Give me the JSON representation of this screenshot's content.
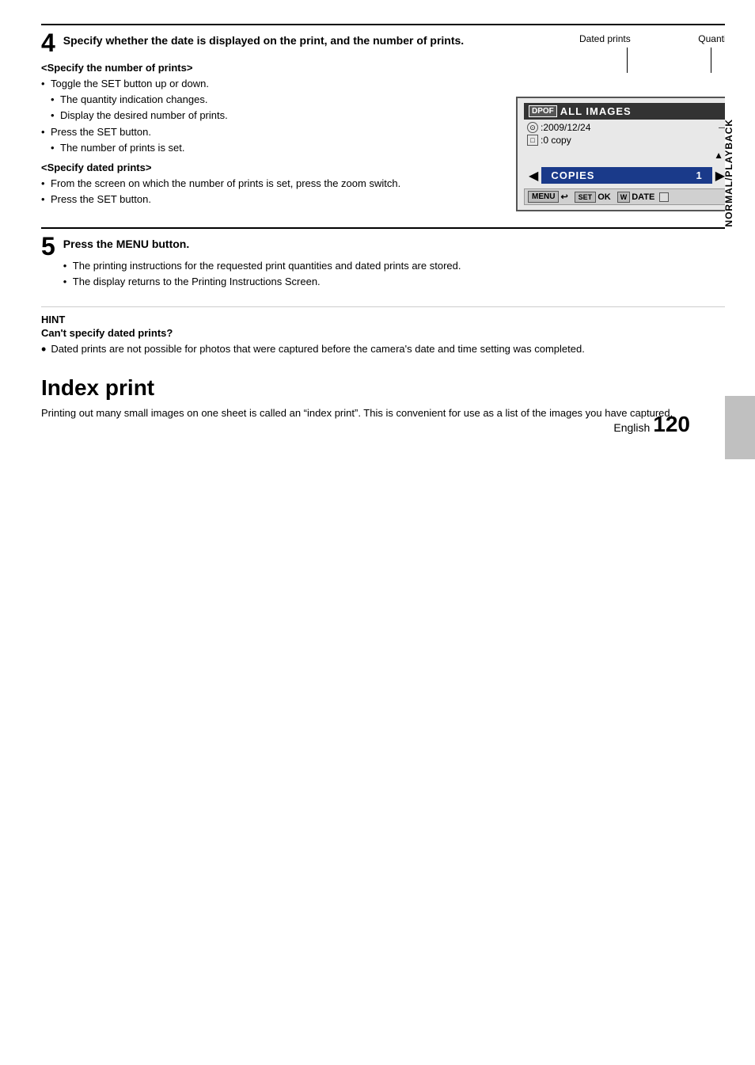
{
  "page": {
    "number": "120",
    "language": "English"
  },
  "side_tab": {
    "text": "NORMAL/PLAYBACK"
  },
  "section4": {
    "step_number": "4",
    "title": "Specify whether the date is displayed on the print, and the number of prints.",
    "specify_number_heading": "<Specify the number of prints>",
    "specify_number_bullets": [
      "Toggle the SET button up or down.",
      "The quantity indication changes.",
      "Display the desired number of prints.",
      "Press the SET button.",
      "The number of prints is set."
    ],
    "specify_dated_heading": "<Specify dated prints>",
    "specify_dated_bullets": [
      "From the screen on which the number of prints is set, press the zoom switch.",
      "Press the SET button."
    ]
  },
  "camera_ui": {
    "label_dated_prints": "Dated prints",
    "label_quantity": "Quantity",
    "dpof_badge": "DPOF",
    "header_text": "ALL IMAGES",
    "row1_icon": "⊙",
    "row1_text": ":2009/12/24",
    "row2_icon": "□",
    "row2_text": ":0 copy",
    "triangle": "▲",
    "copies_label": "COPIES",
    "copies_value": "1",
    "bottom_menu": "MENU",
    "bottom_ok": "OK",
    "bottom_date": "DATE"
  },
  "section5": {
    "step_number": "5",
    "title": "Press the MENU button.",
    "bullets": [
      "The printing instructions for the requested print quantities and dated prints are stored.",
      "The display returns to the Printing Instructions Screen."
    ]
  },
  "hint": {
    "label": "HINT",
    "subtitle": "Can't specify dated prints?",
    "body": "Dated prints are not possible for photos that were captured before the camera's date and time setting was completed."
  },
  "index_print": {
    "title": "Index print",
    "body": "Printing out many small images on one sheet is called an “index print”. This is convenient for use as a list of the images you have captured."
  }
}
